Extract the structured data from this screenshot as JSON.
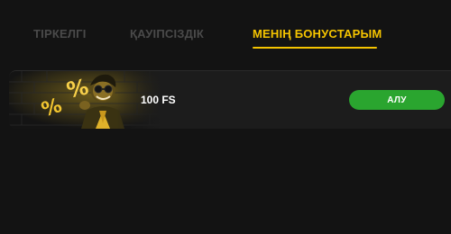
{
  "tabs": [
    {
      "label": "ТІРКЕЛГІ",
      "active": false
    },
    {
      "label": "ҚАУІПСІЗДІК",
      "active": false
    },
    {
      "label": "МЕНІҢ БОНУСТАРЫМ",
      "active": true
    }
  ],
  "bonus": {
    "title": "100 FS",
    "claim_label": "АЛУ",
    "image_icon": "mascot-percent-illustration"
  },
  "colors": {
    "background": "#131313",
    "active_tab": "#f5c400",
    "inactive_tab": "#4a4a4a",
    "button": "#2aa52f"
  }
}
